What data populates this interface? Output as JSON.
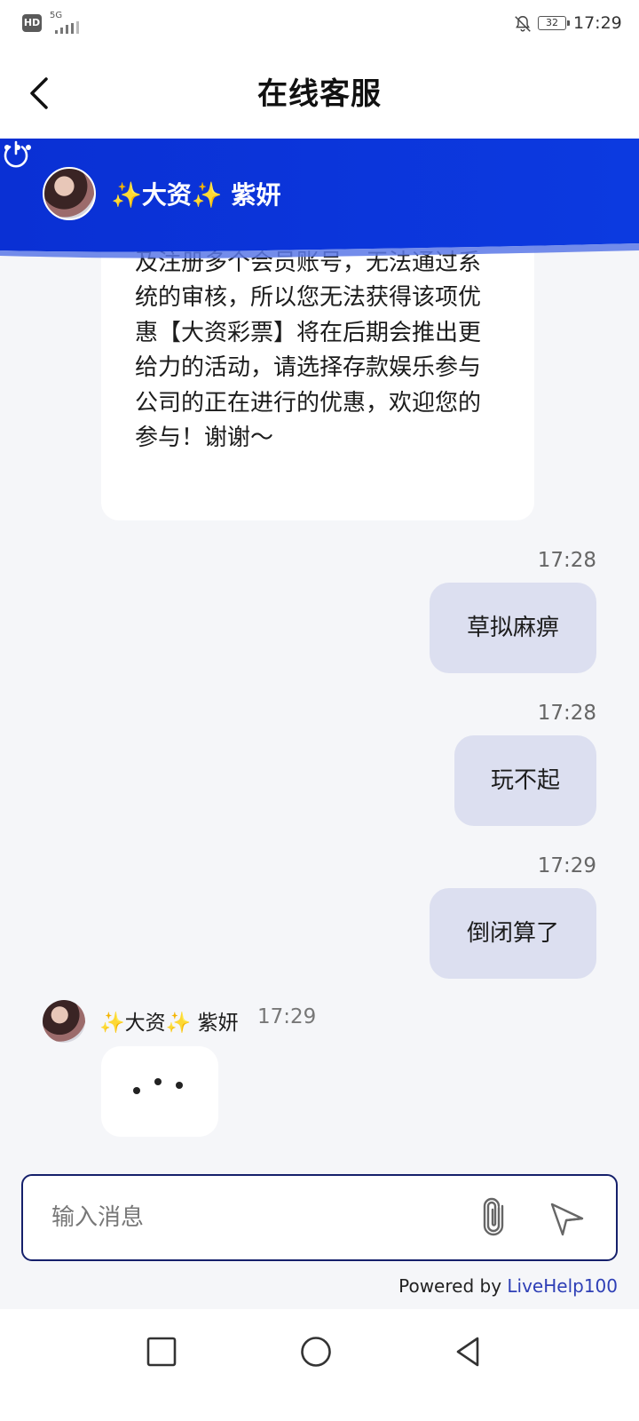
{
  "status_bar": {
    "hd": "HD",
    "network": "5G",
    "battery": "32",
    "time": "17:29"
  },
  "header": {
    "title": "在线客服"
  },
  "agent": {
    "name": "✨大资✨ 紫妍"
  },
  "messages": {
    "first_agent_text": "您好，经过系统审核，地址已经涉及注册多个会员账号，无法通过系统的审核，所以您无法获得该项优惠【大资彩票】将在后期会推出更给力的活动，请选择存款娱乐参与公司的正在进行的优惠，欢迎您的参与！谢谢～",
    "user_msgs": [
      {
        "time": "17:28",
        "text": "草拟麻痹"
      },
      {
        "time": "17:28",
        "text": "玩不起"
      },
      {
        "time": "17:29",
        "text": "倒闭算了"
      }
    ],
    "typing_row": {
      "name": "✨大资✨ 紫妍",
      "time": "17:29"
    }
  },
  "composer": {
    "placeholder": "输入消息"
  },
  "footer": {
    "powered_prefix": "Powered by ",
    "powered_link": "LiveHelp100"
  },
  "colors": {
    "banner": "#0b35d8",
    "user_bubble": "#dcdff0",
    "input_border": "#15206b",
    "link": "#2e3fb6"
  }
}
